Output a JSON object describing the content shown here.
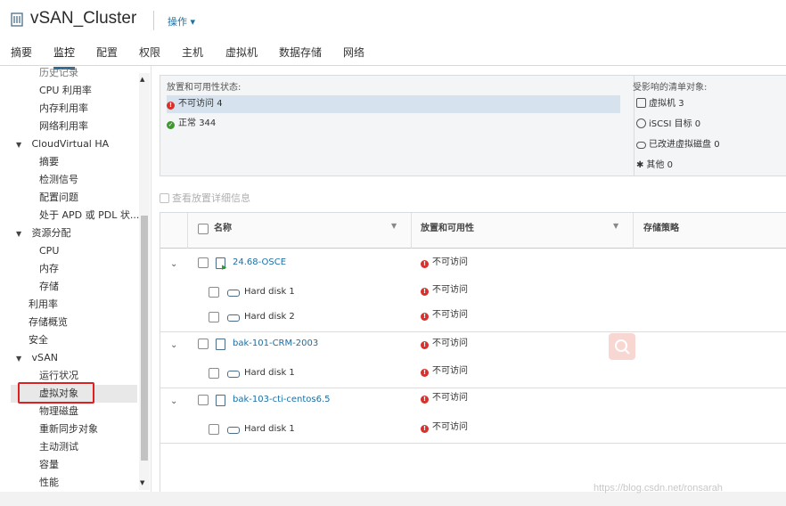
{
  "header": {
    "title": "vSAN_Cluster",
    "actions_label": "操作 ▾"
  },
  "tabs": [
    {
      "label": "摘要"
    },
    {
      "label": "监控"
    },
    {
      "label": "配置"
    },
    {
      "label": "权限"
    },
    {
      "label": "主机"
    },
    {
      "label": "虚拟机"
    },
    {
      "label": "数据存储"
    },
    {
      "label": "网络"
    }
  ],
  "sidebar": {
    "items": [
      {
        "label": "历史记录"
      },
      {
        "label": "CPU 利用率"
      },
      {
        "label": "内存利用率"
      },
      {
        "label": "网络利用率"
      },
      {
        "label": "CloudVirtual HA"
      },
      {
        "label": "摘要"
      },
      {
        "label": "检测信号"
      },
      {
        "label": "配置问题"
      },
      {
        "label": "处于 APD 或 PDL 状..."
      },
      {
        "label": "资源分配"
      },
      {
        "label": "CPU"
      },
      {
        "label": "内存"
      },
      {
        "label": "存储"
      },
      {
        "label": "利用率"
      },
      {
        "label": "存储概览"
      },
      {
        "label": "安全"
      },
      {
        "label": "vSAN"
      },
      {
        "label": "运行状况"
      },
      {
        "label": "虚拟对象"
      },
      {
        "label": "物理磁盘"
      },
      {
        "label": "重新同步对象"
      },
      {
        "label": "主动测试"
      },
      {
        "label": "容量"
      },
      {
        "label": "性能"
      }
    ]
  },
  "summary": {
    "status_title": "放置和可用性状态:",
    "statuses": [
      {
        "label": "不可访问",
        "count": "4"
      },
      {
        "label": "正常",
        "count": "344"
      }
    ],
    "affected_title": "受影响的清单对象:",
    "affected": [
      {
        "label": "虚拟机",
        "count": "3"
      },
      {
        "label": "iSCSI 目标",
        "count": "0"
      },
      {
        "label": "已改进虚拟磁盘",
        "count": "0"
      },
      {
        "label": "其他",
        "count": "0"
      }
    ]
  },
  "view_details_label": "查看放置详细信息",
  "grid": {
    "columns": {
      "name": "名称",
      "placement": "放置和可用性",
      "policy": "存储策略"
    },
    "rows": [
      {
        "name": "24.68-OSCE",
        "status": "不可访问"
      },
      {
        "name": "Hard disk 1",
        "status": "不可访问"
      },
      {
        "name": "Hard disk 2",
        "status": "不可访问"
      },
      {
        "name": "bak-101-CRM-2003",
        "status": "不可访问"
      },
      {
        "name": "Hard disk 1",
        "status": "不可访问"
      },
      {
        "name": "bak-103-cti-centos6.5",
        "status": "不可访问"
      },
      {
        "name": "Hard disk 1",
        "status": "不可访问"
      }
    ]
  },
  "watermark": "https://blog.csdn.net/ronsarah",
  "colors": {
    "accent": "#1c6ea4",
    "error": "#d9302c",
    "ok": "#3d9a2c",
    "highlight_box": "#e02020"
  }
}
